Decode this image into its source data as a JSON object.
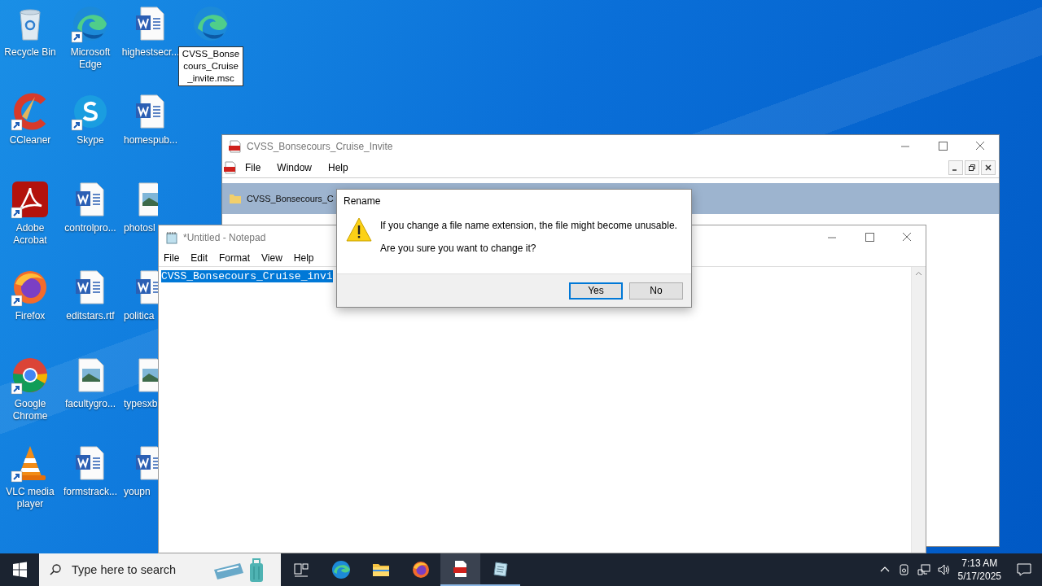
{
  "desktop_icons": [
    {
      "label": "Recycle Bin",
      "kind": "recycle-bin",
      "shortcut": false,
      "editing": false
    },
    {
      "label": "CCleaner",
      "kind": "ccleaner",
      "shortcut": true,
      "editing": false
    },
    {
      "label": "Adobe Acrobat",
      "kind": "acrobat",
      "shortcut": true,
      "editing": false
    },
    {
      "label": "Firefox",
      "kind": "firefox",
      "shortcut": true,
      "editing": false
    },
    {
      "label": "Google Chrome",
      "kind": "chrome",
      "shortcut": true,
      "editing": false
    },
    {
      "label": "VLC media player",
      "kind": "vlc",
      "shortcut": true,
      "editing": false
    },
    {
      "label": "Microsoft Edge",
      "kind": "edge",
      "shortcut": true,
      "editing": false
    },
    {
      "label": "Skype",
      "kind": "skype",
      "shortcut": true,
      "editing": false
    },
    {
      "label": "controlpro...",
      "kind": "word",
      "shortcut": false,
      "editing": false
    },
    {
      "label": "editstars.rtf",
      "kind": "word",
      "shortcut": false,
      "editing": false
    },
    {
      "label": "facultygro...",
      "kind": "image",
      "shortcut": false,
      "editing": false
    },
    {
      "label": "formstrack...",
      "kind": "word",
      "shortcut": false,
      "editing": false
    },
    {
      "label": "highestsecr...",
      "kind": "word",
      "shortcut": false,
      "editing": false
    },
    {
      "label": "homespub...",
      "kind": "word",
      "shortcut": false,
      "editing": false
    },
    {
      "label": "photosl",
      "kind": "image",
      "shortcut": false,
      "editing": false
    },
    {
      "label": "politica",
      "kind": "word",
      "shortcut": false,
      "editing": false
    },
    {
      "label": "typesxb",
      "kind": "image",
      "shortcut": false,
      "editing": false
    },
    {
      "label": "youpn",
      "kind": "word",
      "shortcut": false,
      "editing": false
    },
    {
      "label": "CVSS_Bonsecours_Cruise_invite.msc",
      "kind": "edge",
      "shortcut": false,
      "editing": true
    }
  ],
  "pdf_window": {
    "title": "CVSS_Bonsecours_Cruise_Invite",
    "menu": [
      "File",
      "Window",
      "Help"
    ],
    "panel_item": "CVSS_Bonsecours_C"
  },
  "notepad": {
    "title": "*Untitled - Notepad",
    "menu": [
      "File",
      "Edit",
      "Format",
      "View",
      "Help"
    ],
    "text": "CVSS_Bonsecours_Cruise_invi",
    "selected": true
  },
  "dialog": {
    "title": "Rename",
    "message": "If you change a file name extension, the file might become unusable.",
    "question": "Are you sure you want to change it?",
    "buttons": [
      {
        "label": "Yes",
        "default": true
      },
      {
        "label": "No",
        "default": false
      }
    ]
  },
  "taskbar": {
    "search_placeholder": "Type here to search",
    "apps": [
      {
        "kind": "task-view",
        "running": false,
        "active": false
      },
      {
        "kind": "edge",
        "running": false,
        "active": false
      },
      {
        "kind": "folder",
        "running": false,
        "active": false
      },
      {
        "kind": "firefox",
        "running": false,
        "active": false
      },
      {
        "kind": "pdf",
        "running": true,
        "active": true
      },
      {
        "kind": "notepad",
        "running": true,
        "active": false
      }
    ],
    "time": "7:13 AM",
    "date": "5/17/2025"
  }
}
